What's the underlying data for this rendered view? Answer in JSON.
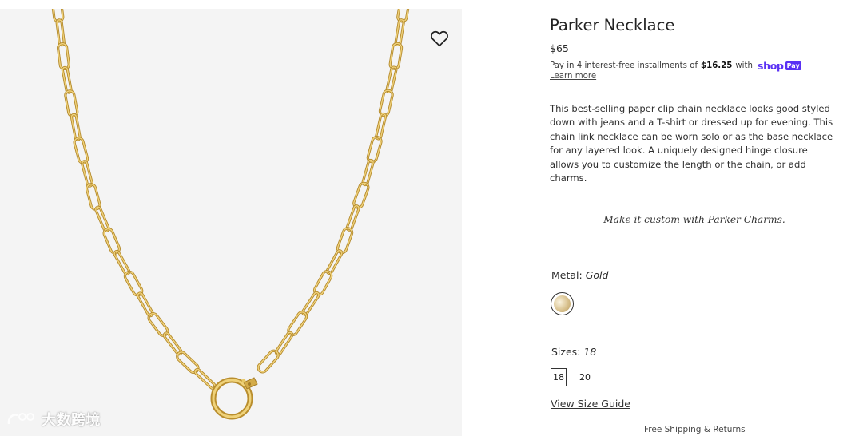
{
  "product": {
    "title": "Parker Necklace",
    "price": "$65",
    "installments": {
      "prefix": "Pay in 4 interest-free installments of",
      "amount": "$16.25",
      "suffix": "with",
      "brand_word": "shop",
      "brand_badge": "Pay",
      "brand_color": "#5a31f4"
    },
    "learn_more": "Learn more",
    "description": "This best-selling paper clip chain necklace looks good styled down with jeans and a T-shirt or dressed up for evening. This chain link necklace can be worn solo or as the base necklace for any layered look. A uniquely designed hinge closure allows you to customize the length or the chain, or add charms.",
    "custom_prefix": "Make it custom with",
    "custom_link": "Parker Charms",
    "custom_suffix": ".",
    "metal": {
      "label": "Metal:",
      "value": "Gold",
      "swatch_color": "#d9c28f"
    },
    "sizes": {
      "label": "Sizes:",
      "value": "18",
      "options": [
        "18",
        "20"
      ],
      "selected": "18"
    },
    "size_guide": "View Size Guide",
    "shipping": "Free Shipping & Returns"
  },
  "gallery": {
    "wishlist_icon": "heart-outline-icon",
    "chain_color": "#d4ac4a",
    "watermark_text": "大数跨境"
  }
}
